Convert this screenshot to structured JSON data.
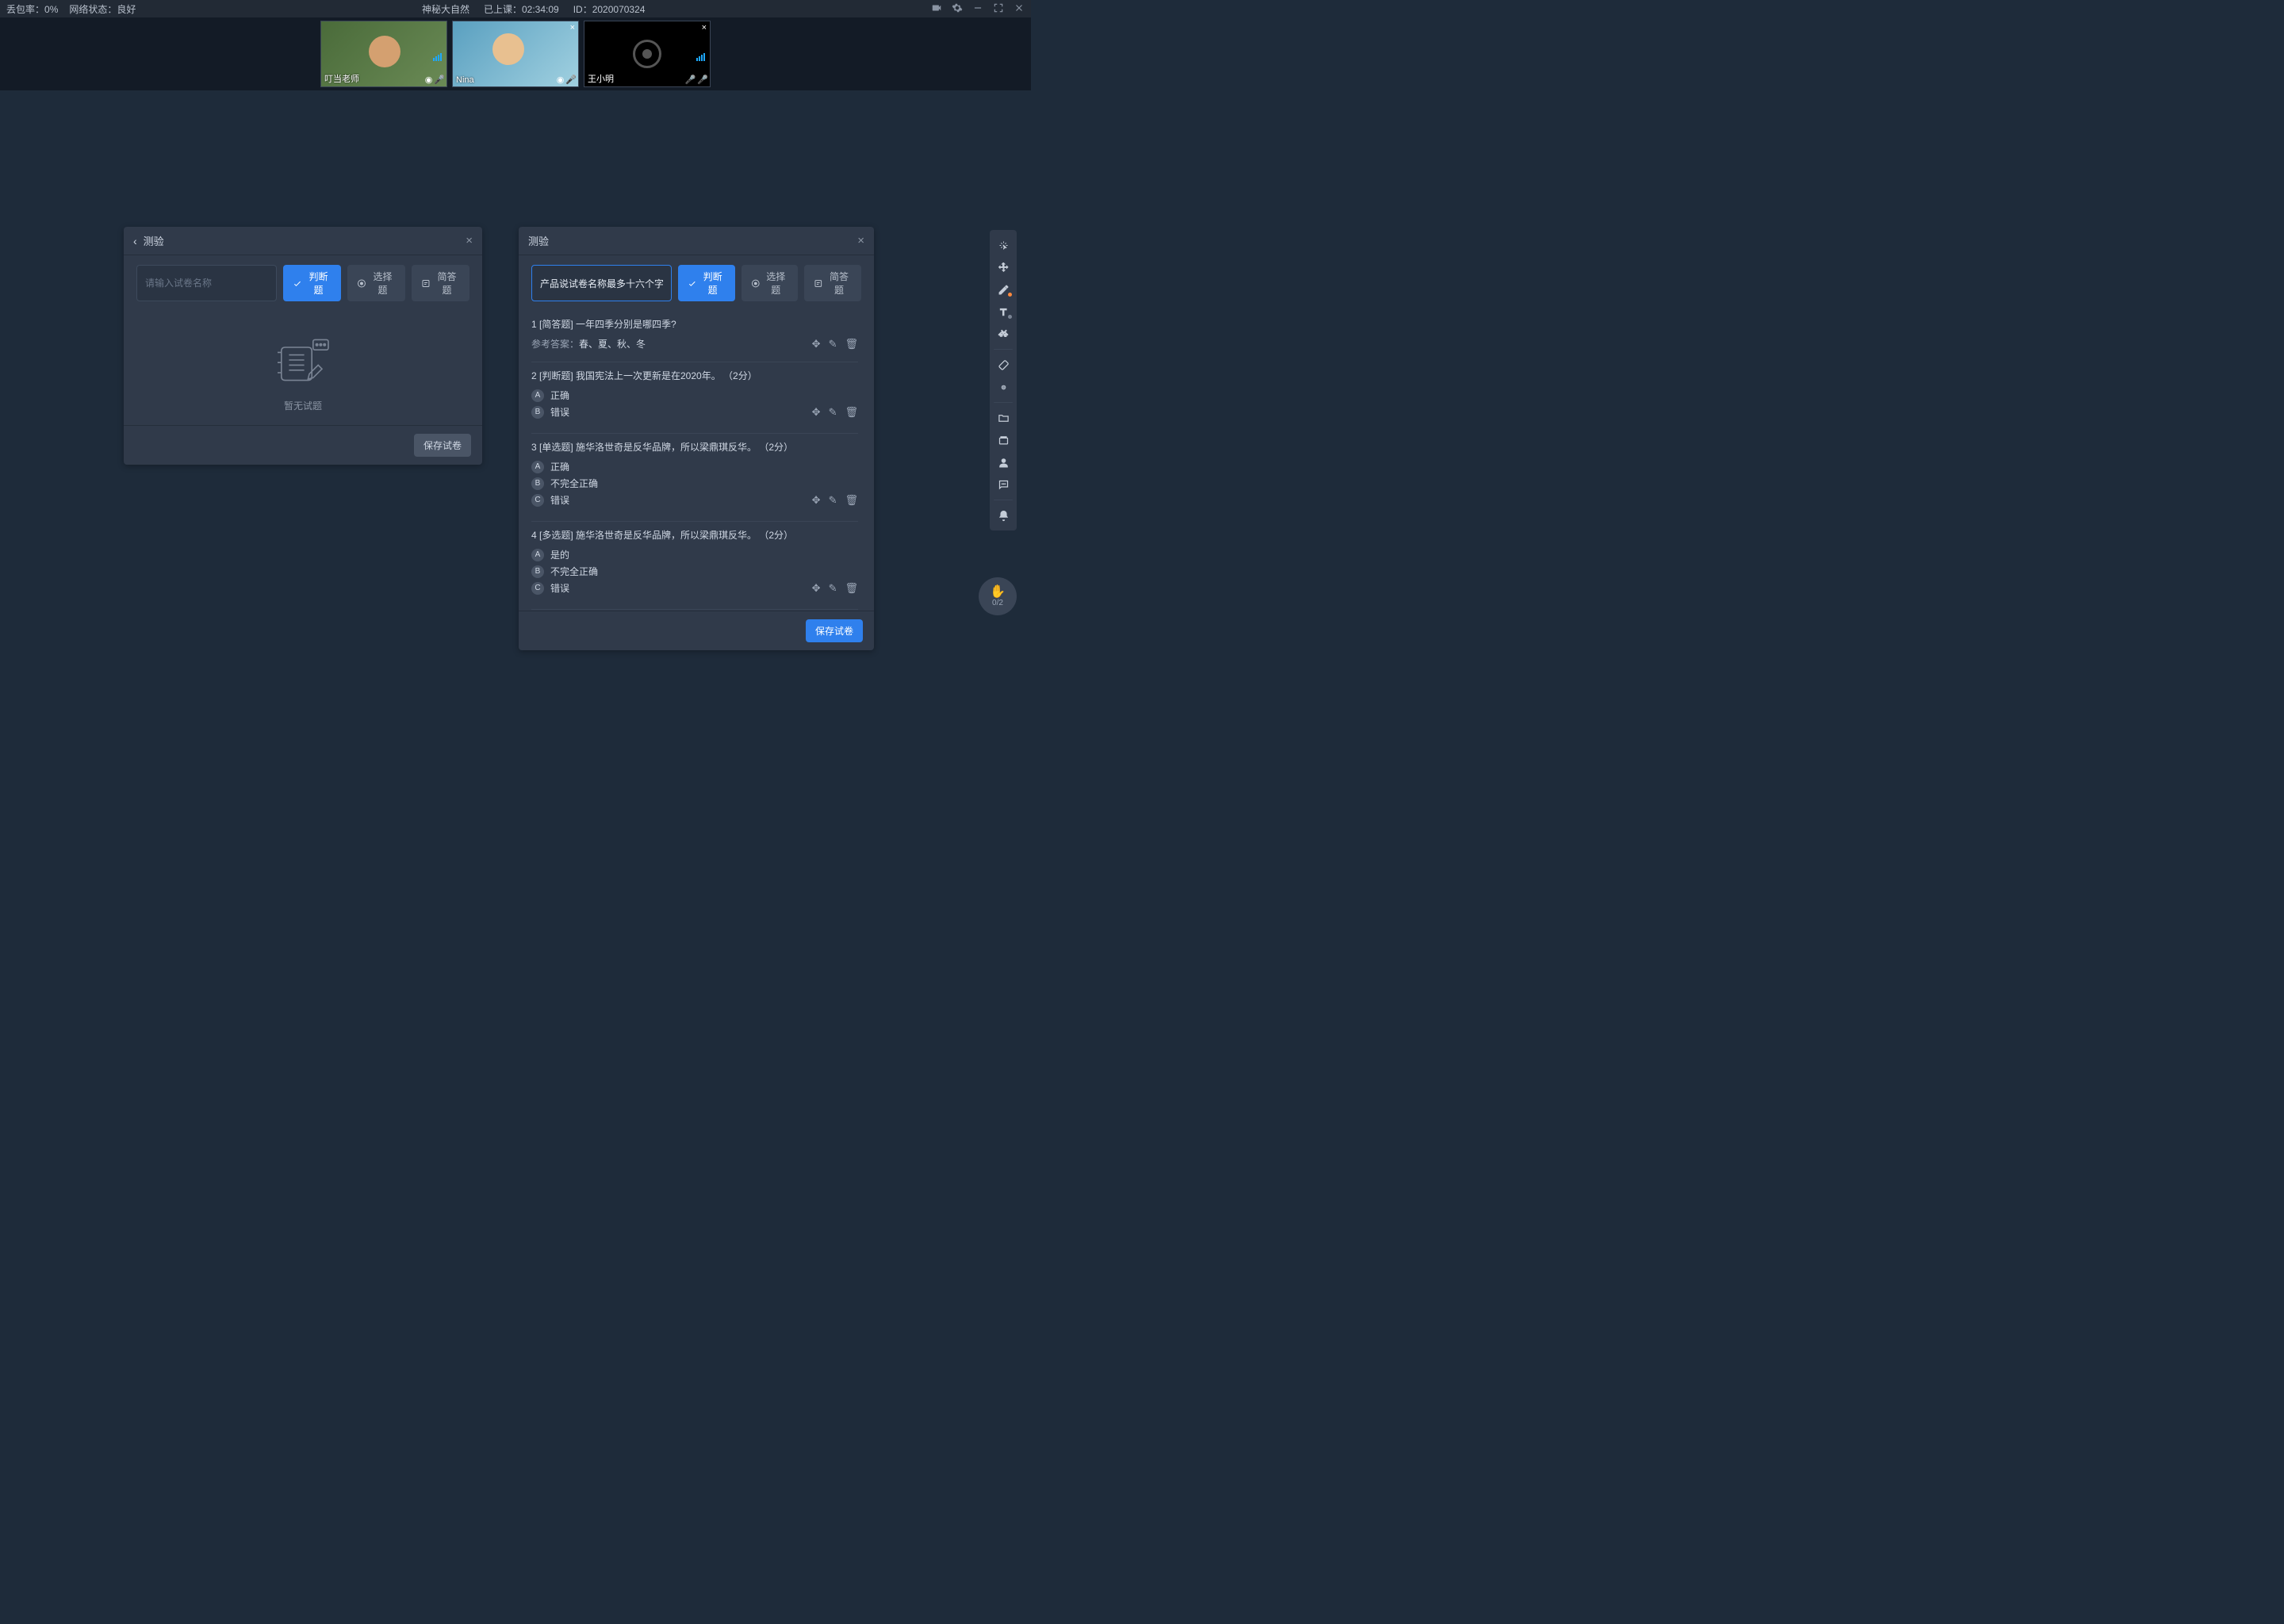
{
  "topbar": {
    "packet_loss_label": "丢包率：",
    "packet_loss_value": "0%",
    "network_label": "网络状态：",
    "network_value": "良好",
    "title": "神秘大自然",
    "time_label": "已上课：",
    "time_value": "02:34:09",
    "id_label": "ID：",
    "id_value": "2020070324"
  },
  "videos": [
    {
      "name": "叮当老师"
    },
    {
      "name": "Nina"
    },
    {
      "name": "王小明"
    }
  ],
  "panel_left": {
    "title": "测验",
    "name_placeholder": "请输入试卷名称",
    "btn_judge": "判断题",
    "btn_choice": "选择题",
    "btn_short": "简答题",
    "empty_text": "暂无试题",
    "save": "保存试卷"
  },
  "panel_right": {
    "title": "测验",
    "name_value": "产品说试卷名称最多十六个字",
    "btn_judge": "判断题",
    "btn_choice": "选择题",
    "btn_short": "简答题",
    "save": "保存试卷",
    "ref_answer_label": "参考答案：",
    "questions": [
      {
        "num": "1",
        "tag": "[简答题]",
        "text": "一年四季分别是哪四季?",
        "ref_answer": "春、夏、秋、冬",
        "options": []
      },
      {
        "num": "2",
        "tag": "[判断题]",
        "text": "我国宪法上一次更新是在2020年。",
        "points": "（2分）",
        "options": [
          {
            "letter": "A",
            "text": "正确"
          },
          {
            "letter": "B",
            "text": "错误"
          }
        ]
      },
      {
        "num": "3",
        "tag": "[单选题]",
        "text": "施华洛世奇是反华品牌，所以梁鼎琪反华。",
        "points": "（2分）",
        "options": [
          {
            "letter": "A",
            "text": "正确"
          },
          {
            "letter": "B",
            "text": "不完全正确"
          },
          {
            "letter": "C",
            "text": "错误"
          }
        ]
      },
      {
        "num": "4",
        "tag": "[多选题]",
        "text": "施华洛世奇是反华品牌，所以梁鼎琪反华。",
        "points": "（2分）",
        "options": [
          {
            "letter": "A",
            "text": "是的"
          },
          {
            "letter": "B",
            "text": "不完全正确"
          },
          {
            "letter": "C",
            "text": "错误"
          }
        ]
      }
    ]
  },
  "hand": {
    "count": "0/2"
  },
  "icons": {
    "move": "✥",
    "edit": "✎",
    "delete": "🗑"
  }
}
